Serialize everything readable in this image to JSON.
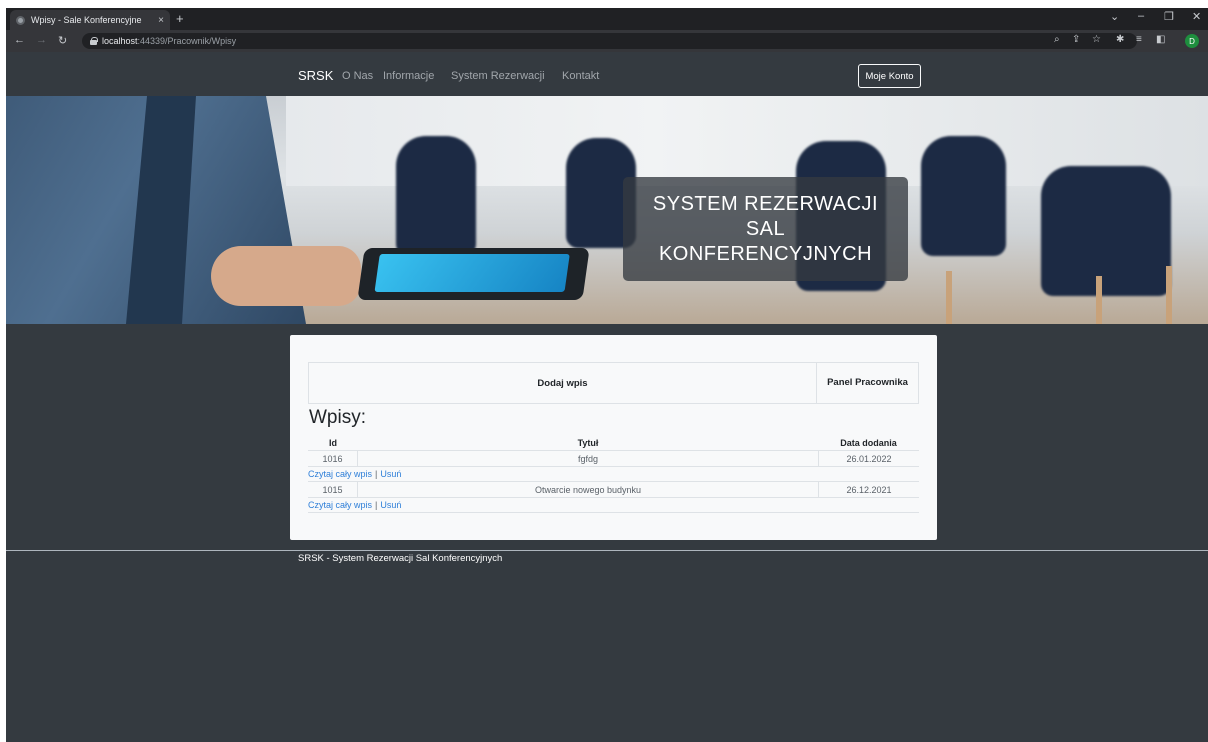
{
  "browser": {
    "tab_title": "Wpisy - Sale Konferencyjne",
    "tab_close": "×",
    "new_tab": "+",
    "url_host": "localhost",
    "url_rest": ":44339/Pracownik/Wpisy",
    "win_min": "–",
    "win_max": "❐",
    "win_close": "✕",
    "win_chevron": "⌄",
    "profile_initial": "D"
  },
  "navbar": {
    "brand": "SRSK",
    "links": [
      "O Nas",
      "Informacje",
      "System Rezerwacji",
      "Kontakt"
    ],
    "account_button": "Moje Konto"
  },
  "hero": {
    "title": "SYSTEM REZERWACJI SAL KONFERENCYJNYCH"
  },
  "panel": {
    "add_entry": "Dodaj wpis",
    "staff_panel": "Panel Pracownika"
  },
  "entries": {
    "heading": "Wpisy:",
    "columns": [
      "Id",
      "Tytuł",
      "Data dodania"
    ],
    "rows": [
      {
        "id": "1016",
        "title": "fgfdg",
        "date": "26.01.2022"
      },
      {
        "id": "1015",
        "title": "Otwarcie nowego budynku",
        "date": "26.12.2021"
      }
    ],
    "read_link": "Czytaj cały wpis",
    "separator": "|",
    "delete_link": "Usuń"
  },
  "footer": {
    "text": "SRSK - System Rezerwacji Sal Konferencyjnych"
  },
  "colors": {
    "page_bg": "#343a40",
    "card_bg": "#f8f9fa",
    "link": "#2f7fd8",
    "chrome": "#202124"
  }
}
